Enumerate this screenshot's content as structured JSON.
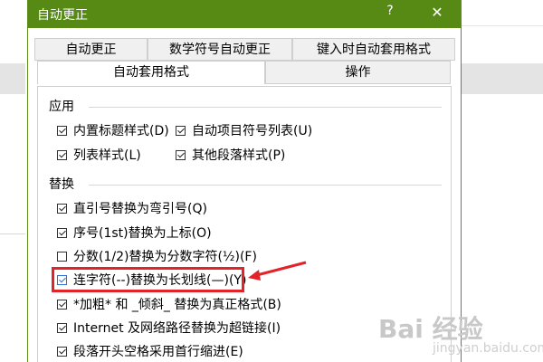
{
  "dialog": {
    "title": "自动更正",
    "help": "?",
    "close": "✕"
  },
  "tabs": {
    "row1": [
      "自动更正",
      "数学符号自动更正",
      "键入时自动套用格式"
    ],
    "row2": [
      "自动套用格式",
      "操作"
    ],
    "active": "自动套用格式"
  },
  "groups": {
    "apply": "应用",
    "replace": "替换"
  },
  "apply_options": [
    {
      "label": "内置标题样式(D)",
      "checked": true
    },
    {
      "label": "自动项目符号列表(U)",
      "checked": true
    },
    {
      "label": "列表样式(L)",
      "checked": true
    },
    {
      "label": "其他段落样式(P)",
      "checked": true
    }
  ],
  "replace_options": [
    {
      "label": "直引号替换为弯引号(Q)",
      "checked": true
    },
    {
      "label": "序号(1st)替换为上标(O)",
      "checked": true
    },
    {
      "label": "分数(1/2)替换为分数字符(½)(F)",
      "checked": false
    },
    {
      "label": "连字符(--)替换为长划线(—)(Y)",
      "checked": true
    },
    {
      "label": "*加粗* 和 _倾斜_ 替换为真正格式(B)",
      "checked": true
    },
    {
      "label": "Internet 及网络路径替换为超链接(I)",
      "checked": true
    },
    {
      "label": "段落开头空格采用首行缩进(E)",
      "checked": true
    }
  ],
  "watermark": {
    "main": "Bai 经验",
    "sub": "jingyan.baidu.com"
  },
  "colors": {
    "titlebar": "#568a14",
    "highlight": "#e2232a"
  }
}
